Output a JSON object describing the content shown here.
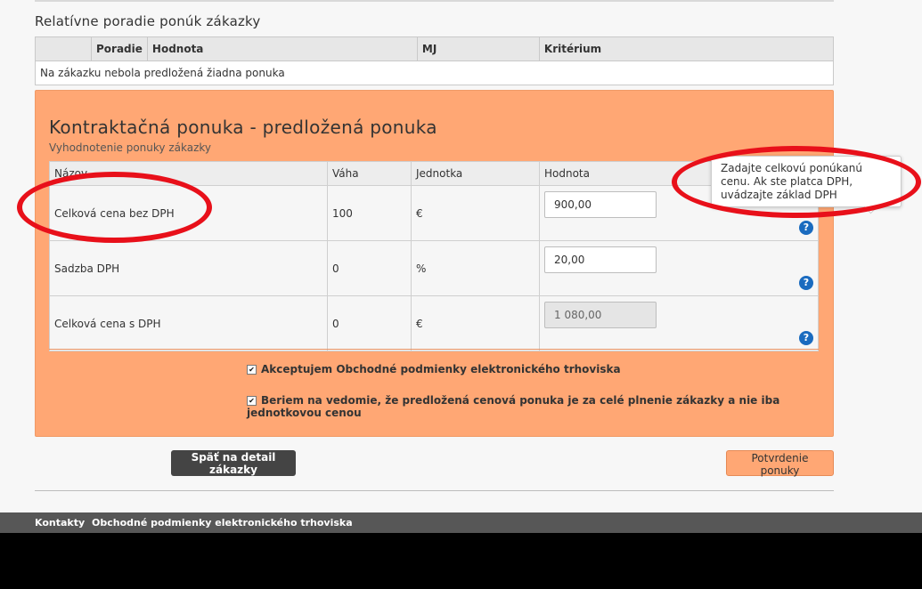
{
  "relative": {
    "title": "Relatívne poradie ponúk zákazky",
    "columns": [
      "",
      "Poradie",
      "Hodnota",
      "MJ",
      "Kritérium"
    ],
    "empty_text": "Na zákazku nebola predložená žiadna ponuka"
  },
  "offer": {
    "title": "Kontraktačná ponuka - predložená ponuka",
    "subtitle": "Vyhodnotenie ponuky zákazky",
    "columns": {
      "name": "Názov",
      "weight": "Váha",
      "unit": "Jednotka",
      "value": "Hodnota"
    },
    "rows": [
      {
        "name": "Celková cena bez DPH",
        "weight": "100",
        "unit": "€",
        "value": "900,00",
        "readonly": false
      },
      {
        "name": "Sadzba DPH",
        "weight": "0",
        "unit": "%",
        "value": "20,00",
        "readonly": false
      },
      {
        "name": "Celková cena s DPH",
        "weight": "0",
        "unit": "€",
        "value": "1 080,00",
        "readonly": true
      }
    ],
    "help_glyph": "?"
  },
  "agreements": {
    "terms": "Akceptujem Obchodné podmienky elektronického trhoviska",
    "price_notice": "Beriem na vedomie, že predložená cenová ponuka je za celé plnenie zákazky a nie iba jednotkovou cenou",
    "checkmark": "✔"
  },
  "buttons": {
    "back": "Späť na detail zákazky",
    "confirm": "Potvrdenie ponuky"
  },
  "tooltip": {
    "text": "Zadajte celkovú ponúkanú cenu. Ak ste platca DPH, uvádzajte základ DPH"
  },
  "footer": {
    "contacts": "Kontakty",
    "terms": "Obchodné podmienky elektronického trhoviska"
  },
  "colors": {
    "panel": "#ffa774",
    "help_icon": "#1a6bbf",
    "annotation": "#e8101a",
    "footer": "#575757"
  }
}
